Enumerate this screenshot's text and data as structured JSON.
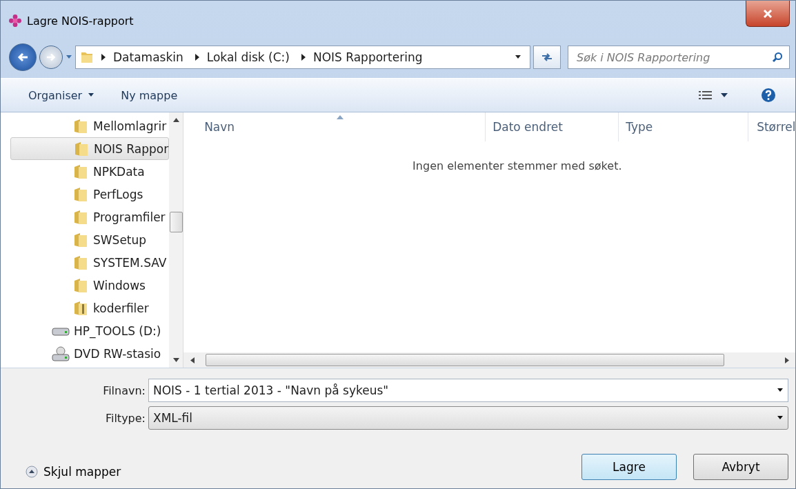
{
  "window": {
    "title": "Lagre NOIS-rapport"
  },
  "address": {
    "crumbs": [
      "Datamaskin",
      "Lokal disk (C:)",
      "NOIS Rapportering"
    ],
    "search_placeholder": "Søk i NOIS Rapportering"
  },
  "toolbar": {
    "organize": "Organiser",
    "new_folder": "Ny mappe"
  },
  "sidebar": {
    "items": [
      {
        "label": "Mellomlagrir",
        "kind": "folder",
        "selected": false
      },
      {
        "label": "NOIS Rappor",
        "kind": "folder",
        "selected": true
      },
      {
        "label": "NPKData",
        "kind": "folder",
        "selected": false
      },
      {
        "label": "PerfLogs",
        "kind": "folder",
        "selected": false
      },
      {
        "label": "Programfiler",
        "kind": "folder",
        "selected": false
      },
      {
        "label": "SWSetup",
        "kind": "folder",
        "selected": false
      },
      {
        "label": "SYSTEM.SAV",
        "kind": "folder",
        "selected": false
      },
      {
        "label": "Windows",
        "kind": "folder",
        "selected": false
      },
      {
        "label": "koderfiler",
        "kind": "zip",
        "selected": false
      },
      {
        "label": "HP_TOOLS (D:)",
        "kind": "drive",
        "selected": false
      },
      {
        "label": "DVD RW-stasio",
        "kind": "dvd",
        "selected": false
      }
    ]
  },
  "table": {
    "columns": [
      "Navn",
      "Dato endret",
      "Type",
      "Størrel"
    ],
    "empty_message": "Ingen elementer stemmer med søket."
  },
  "form": {
    "filename_label": "Filnavn:",
    "filename": "NOIS - 1 tertial 2013 - \"Navn på sykeus\"",
    "filetype_label": "Filtype:",
    "filetype": "XML-fil"
  },
  "footer": {
    "hide_folders": "Skjul mapper",
    "buttons": [
      "Lagre",
      "Avbryt"
    ]
  }
}
